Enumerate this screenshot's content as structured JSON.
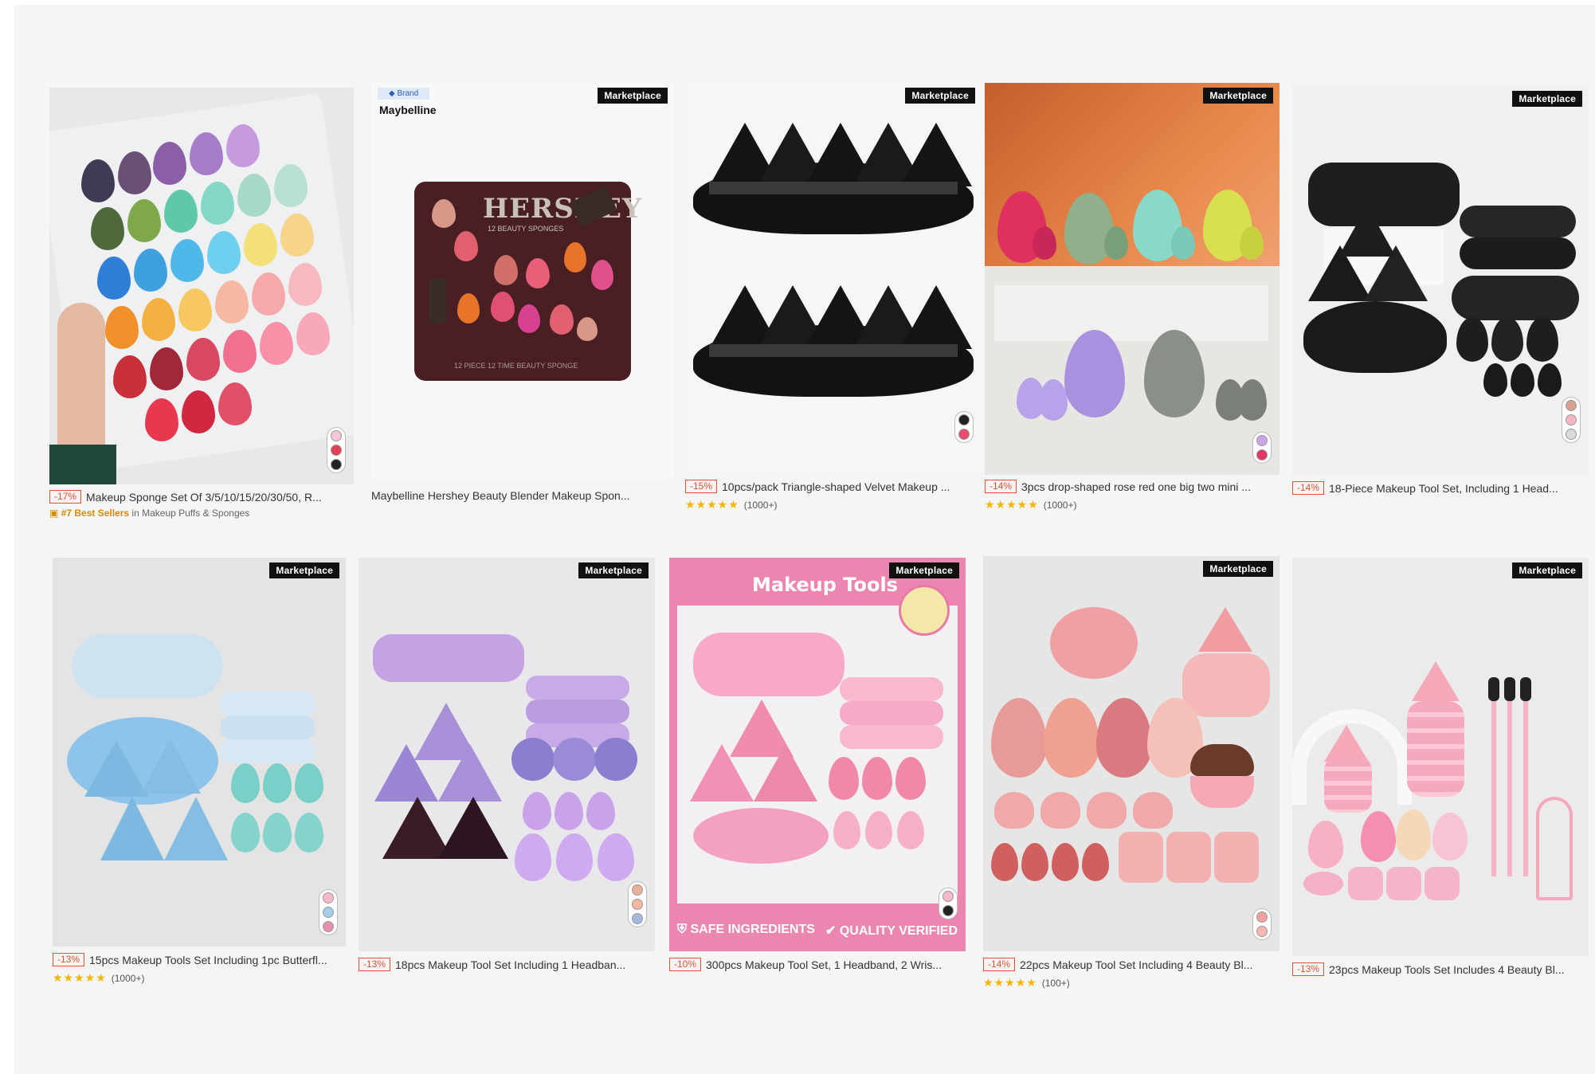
{
  "badges": {
    "marketplace": "Marketplace",
    "brand": "◆ Brand"
  },
  "products": [
    {
      "discount": "-17%",
      "title": "Makeup Sponge Set Of 3/5/10/15/20/30/50, R...",
      "bestseller_rank": "#7 Best Sellers",
      "bestseller_category": "in Makeup Puffs & Sponges",
      "swatches": [
        "#f4c7d4",
        "#e04050",
        "#222222"
      ]
    },
    {
      "brand": "Maybelline",
      "title": "Maybelline Hershey Beauty Blender Makeup Spon...",
      "package_title": "HERSHEY",
      "package_subtitle": "12 BEAUTY SPONGES",
      "package_footer": "12 PIECE 12 TIME BEAUTY SPONGE"
    },
    {
      "discount": "-15%",
      "title": "10pcs/pack Triangle-shaped Velvet Makeup ...",
      "stars": "★★★★★",
      "reviews": "(1000+)",
      "swatches": [
        "#222222",
        "#e84c6f"
      ]
    },
    {
      "discount": "-14%",
      "title": "3pcs drop-shaped rose red one big two mini ...",
      "stars": "★★★★★",
      "reviews": "(1000+)",
      "swatches": [
        "#c9a6e8",
        "#e03a64"
      ]
    },
    {
      "discount": "-14%",
      "title": "18-Piece Makeup Tool Set, Including 1 Head...",
      "swatches": [
        "#d8a08f",
        "#f2b8c0",
        "#d9d9d9"
      ]
    },
    {
      "discount": "-13%",
      "title": "15pcs Makeup Tools Set Including 1pc Butterfl...",
      "stars": "★★★★★",
      "reviews": "(1000+)",
      "swatches": [
        "#f4b8c8",
        "#a6cde8",
        "#e890b0"
      ]
    },
    {
      "discount": "-13%",
      "title": "18pcs Makeup Tool Set Including 1 Headban...",
      "swatches": [
        "#e8b09a",
        "#f4b8a0",
        "#a6b8e0"
      ]
    },
    {
      "discount": "-10%",
      "title": "300pcs Makeup Tool Set, 1 Headband, 2 Wris...",
      "banner": "Makeup Tools",
      "footer_left": "SAFE INGREDIENTS",
      "footer_right": "QUALITY VERIFIED",
      "swatches": [
        "#f4b8c8",
        "#222222"
      ]
    },
    {
      "discount": "-14%",
      "title": "22pcs Makeup Tool Set Including 4 Beauty Bl...",
      "stars": "★★★★★",
      "reviews": "(100+)",
      "swatches": [
        "#f0a0a0",
        "#f4b8b0"
      ]
    },
    {
      "discount": "-13%",
      "title": "23pcs Makeup Tools Set Includes 4 Beauty Bl..."
    }
  ]
}
